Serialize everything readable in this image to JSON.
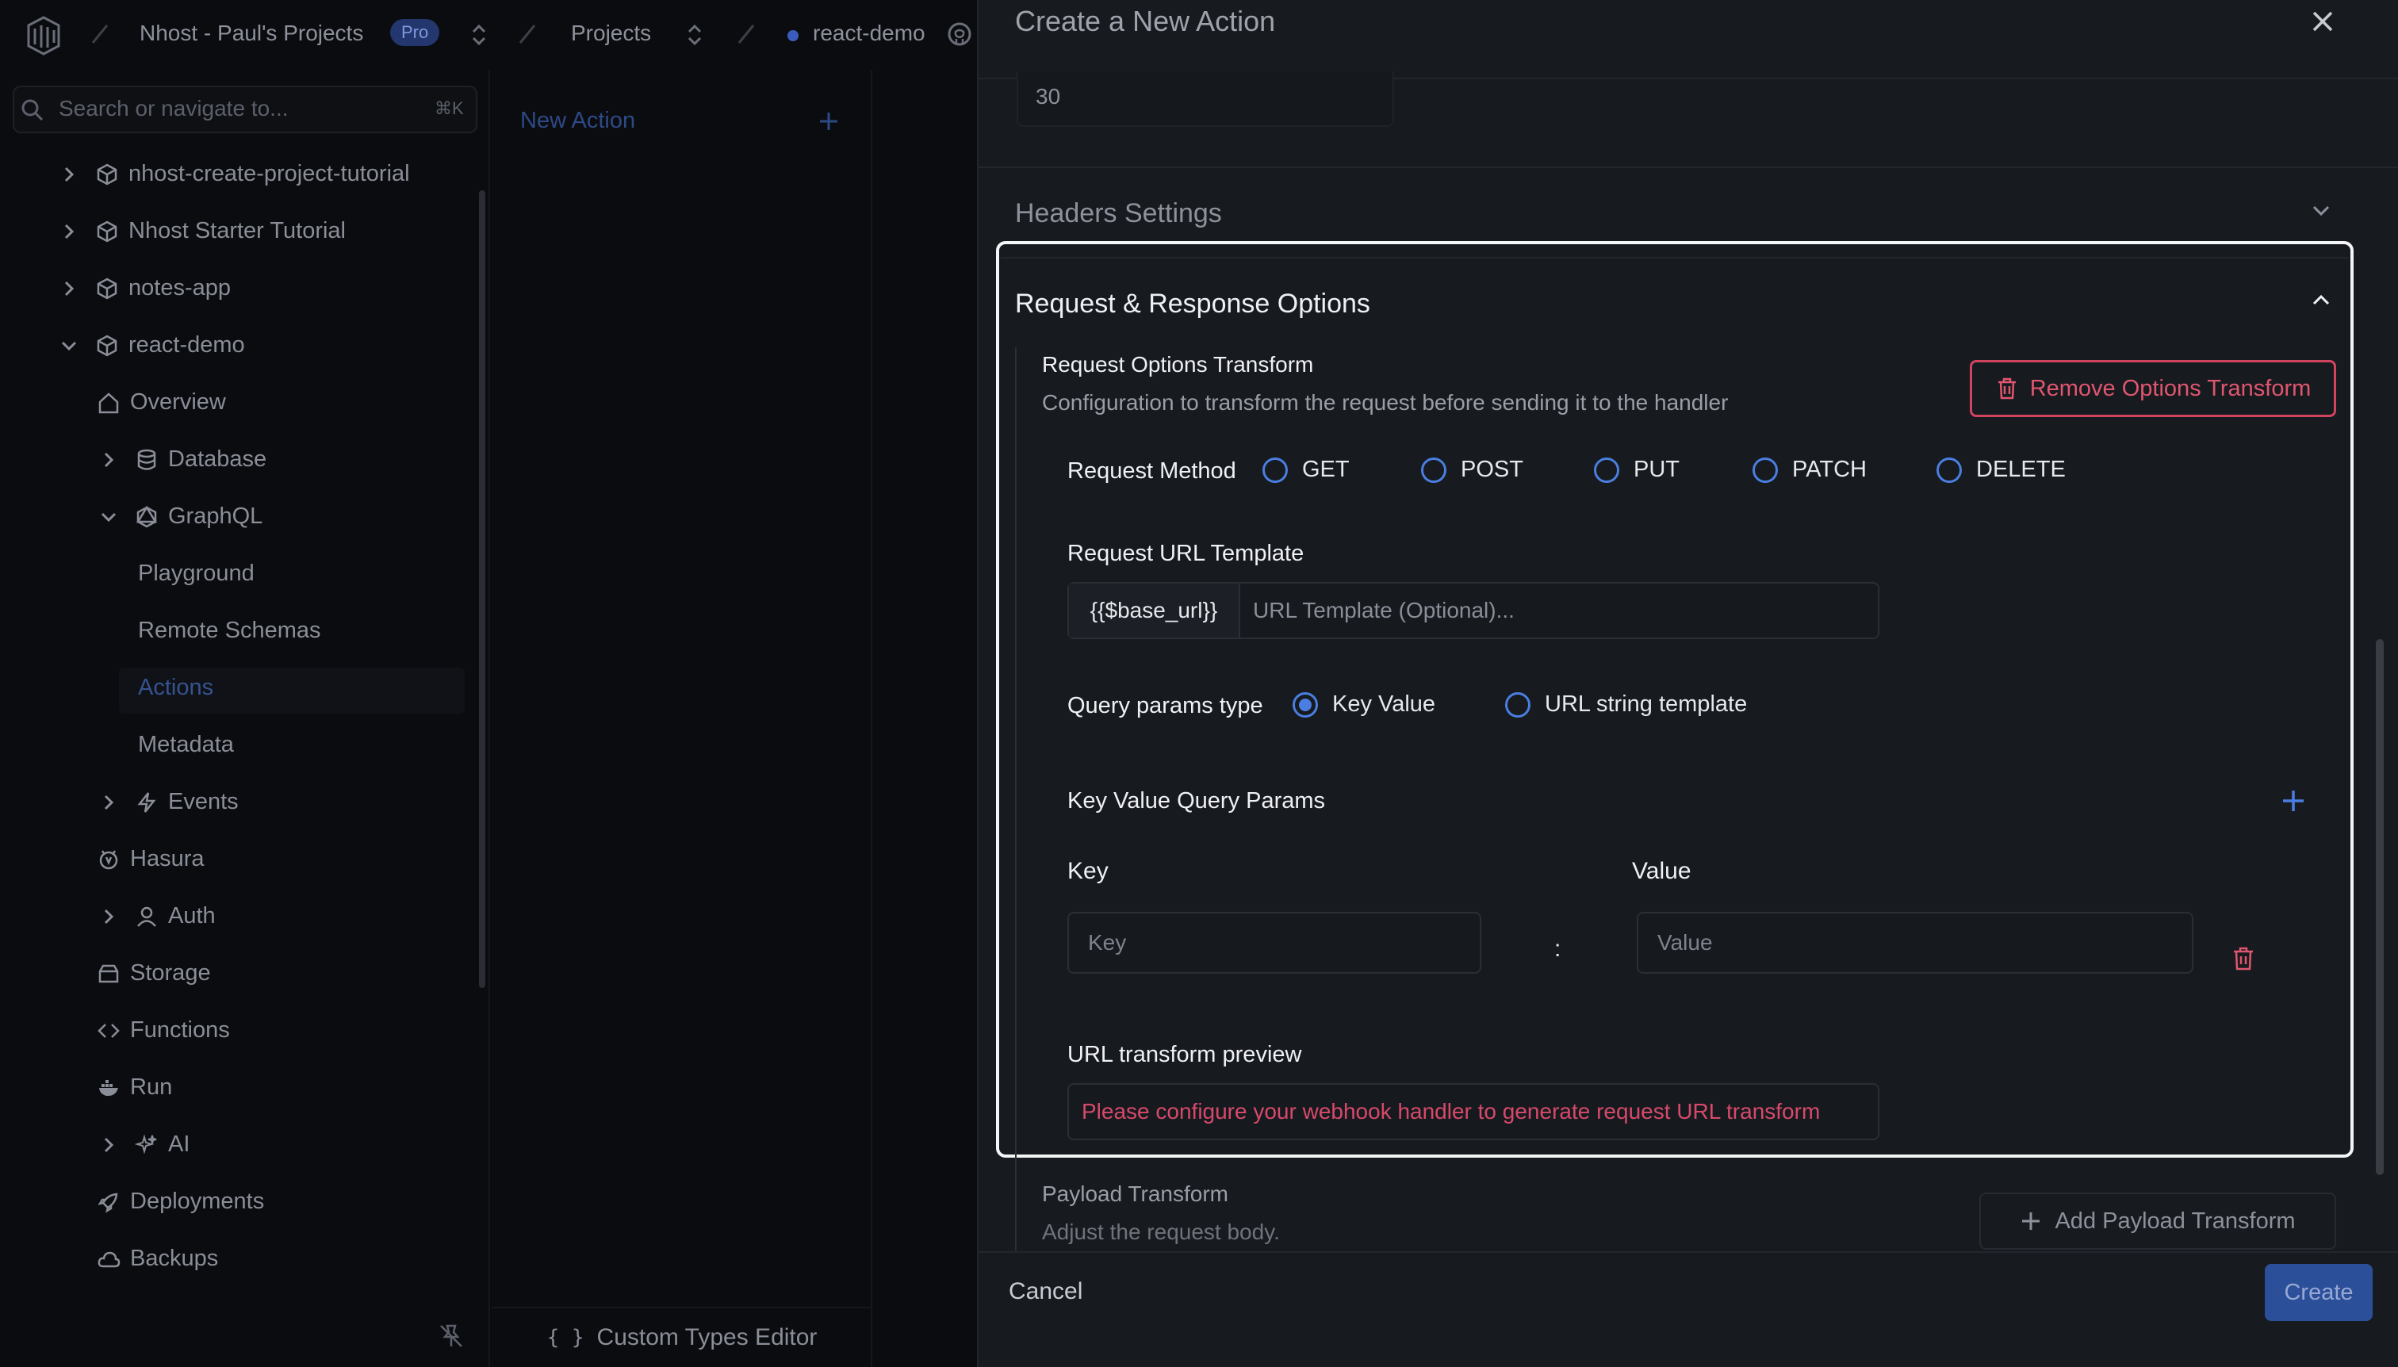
{
  "topbar": {
    "org": "Nhost - Paul's Projects",
    "plan_badge": "Pro",
    "projects": "Projects",
    "project": "react-demo"
  },
  "sidebar": {
    "search_placeholder": "Search or navigate to...",
    "search_shortcut": "⌘K",
    "items": [
      {
        "label": "nhost-create-project-tutorial"
      },
      {
        "label": "Nhost Starter Tutorial"
      },
      {
        "label": "notes-app"
      },
      {
        "label": "react-demo"
      },
      {
        "label": "Overview"
      },
      {
        "label": "Database"
      },
      {
        "label": "GraphQL"
      },
      {
        "label": "Playground"
      },
      {
        "label": "Remote Schemas"
      },
      {
        "label": "Actions"
      },
      {
        "label": "Metadata"
      },
      {
        "label": "Events"
      },
      {
        "label": "Hasura"
      },
      {
        "label": "Auth"
      },
      {
        "label": "Storage"
      },
      {
        "label": "Functions"
      },
      {
        "label": "Run"
      },
      {
        "label": "AI"
      },
      {
        "label": "Deployments"
      },
      {
        "label": "Backups"
      }
    ]
  },
  "actions_panel": {
    "new_action": "New Action",
    "custom_types": "Custom Types Editor",
    "braces": "{ }"
  },
  "drawer": {
    "title": "Create a New Action",
    "timeout_value": "30",
    "headers_settings": "Headers Settings",
    "request_response": "Request & Response Options",
    "request_options_transform": {
      "title": "Request Options Transform",
      "description": "Configuration to transform the request before sending it to the handler",
      "remove_button": "Remove Options Transform"
    },
    "request_method": {
      "label": "Request Method",
      "options": [
        "GET",
        "POST",
        "PUT",
        "PATCH",
        "DELETE"
      ],
      "selected": ""
    },
    "url_template": {
      "label": "Request URL Template",
      "prefix": "{{$base_url}}",
      "placeholder": "URL Template (Optional)..."
    },
    "query_params_type": {
      "label": "Query params type",
      "options": [
        "Key Value",
        "URL string template"
      ],
      "selected": "Key Value"
    },
    "key_value": {
      "title": "Key Value Query Params",
      "key_header": "Key",
      "value_header": "Value",
      "key_placeholder": "Key",
      "value_placeholder": "Value",
      "separator": ":"
    },
    "url_preview": {
      "label": "URL transform preview",
      "message": "Please configure your webhook handler to generate request URL transform"
    },
    "payload_transform": {
      "title": "Payload Transform",
      "description": "Adjust the request body.",
      "add_button": "Add Payload Transform"
    },
    "footer": {
      "cancel": "Cancel",
      "create": "Create"
    }
  },
  "colors": {
    "accent_blue": "#4a7ee0",
    "danger": "#e0566f",
    "drawer_bg": "#171a1f",
    "backdrop": "#0b0c0f"
  }
}
